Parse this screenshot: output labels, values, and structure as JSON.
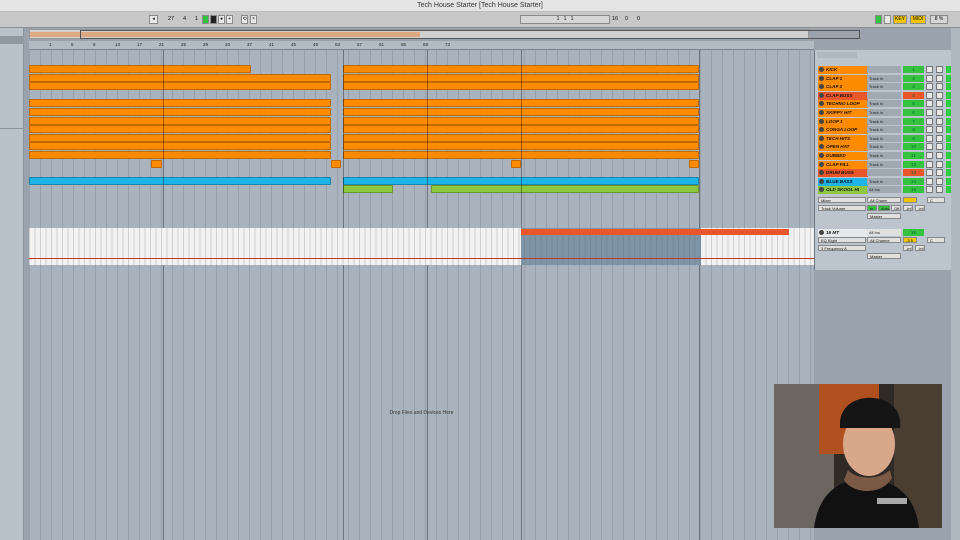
{
  "window": {
    "title": "Tech House Starter  [Tech House Starter]"
  },
  "transport": {
    "tempo": "27",
    "sig_num": "4",
    "sig_den": "1",
    "position": [
      "1",
      "1",
      "1"
    ],
    "loop_length": "16",
    "loop_end": "0",
    "loop_end2": "0",
    "key_label": "KEY",
    "midi_label": "MIDI",
    "cpu": "8 %"
  },
  "ruler": {
    "labels": [
      "1",
      "5",
      "9",
      "13",
      "17",
      "21",
      "25",
      "29",
      "33",
      "37",
      "41",
      "45",
      "49",
      "53",
      "57",
      "61",
      "65",
      "69",
      "73"
    ]
  },
  "arrangement": {
    "drop_text": "Drop Files and Devices Here"
  },
  "tracks": [
    {
      "name": "KICK",
      "input": "",
      "num": "1",
      "color": "#ff8c00"
    },
    {
      "name": "CLAP 1",
      "input": "Track In",
      "num": "2",
      "color": "#ff8c00"
    },
    {
      "name": "CLAP 2",
      "input": "Track In",
      "num": "3",
      "color": "#ff8c00"
    },
    {
      "name": "CLAP BUSS",
      "input": "",
      "num": "4",
      "color": "#e8562a"
    },
    {
      "name": "TECHNO LOOP",
      "input": "Track In",
      "num": "5",
      "color": "#ff8c00"
    },
    {
      "name": "SKIPPY HIT",
      "input": "Track In",
      "num": "6",
      "color": "#ff8c00"
    },
    {
      "name": "LOOP 1",
      "input": "Track In",
      "num": "7",
      "color": "#ff8c00"
    },
    {
      "name": "CONGA LOOP",
      "input": "Track In",
      "num": "8",
      "color": "#ff8c00"
    },
    {
      "name": "TECH HITS",
      "input": "Track In",
      "num": "9",
      "color": "#ff8c00"
    },
    {
      "name": "OPEN HAT",
      "input": "Track In",
      "num": "10",
      "color": "#ff8c00"
    },
    {
      "name": "DUBBED",
      "input": "Track In",
      "num": "11",
      "color": "#ff8c00"
    },
    {
      "name": "CLAP FILL",
      "input": "Track In",
      "num": "12",
      "color": "#ff8c00"
    },
    {
      "name": "DRUM BUSS",
      "input": "",
      "num": "13",
      "color": "#e8562a"
    },
    {
      "name": "BLUE BASS",
      "input": "Track In",
      "num": "14",
      "color": "#1fb4e8"
    },
    {
      "name": "OLD SKOOL HI",
      "input": "All Ins",
      "num": "15",
      "color": "#8dc63f"
    }
  ],
  "mixer": {
    "old_skool": {
      "input_type": "All Chann",
      "mode": "Mixer",
      "automation": "Track Volume",
      "output": "Master",
      "value1": "-inf",
      "value2": "-inf",
      "pan": "C"
    },
    "sixteen_mt": {
      "name": "16 MT",
      "input": "All Ins",
      "input_channel": "All Channe",
      "device": "EQ Eight",
      "param": "3 Frequency A",
      "output": "Master",
      "num": "16",
      "value": "-3.5",
      "pan": "C",
      "value1": "-inf",
      "value2": "-inf"
    },
    "buttons": {
      "s": "S",
      "monitor_in": "In",
      "monitor_auto": "Auto",
      "monitor_off": "Off"
    }
  },
  "colors": {
    "orange": "#ff8c00",
    "blue": "#1fb4e8",
    "green": "#8dc63f",
    "red": "#e8562a",
    "track_green": "#35c23f"
  }
}
